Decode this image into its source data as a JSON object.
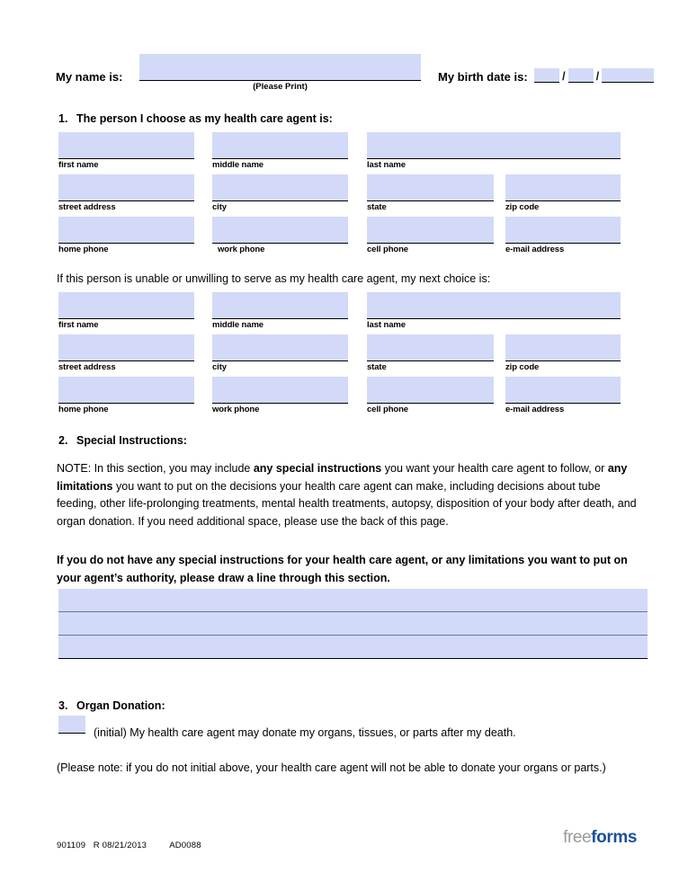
{
  "header": {
    "name_label": "My name is:",
    "please_print": "(Please Print)",
    "birth_label": "My birth date is:",
    "birth_month": "",
    "birth_day": "",
    "birth_year": "",
    "slash": "/",
    "name_value": ""
  },
  "section1": {
    "number": "1.",
    "title": "The person I choose as my health care agent is:",
    "alternate_intro": "If this person is unable or unwilling to serve as my health care agent, my next choice is:",
    "captions": {
      "first_name": "first name",
      "middle_name": "middle name",
      "last_name": "last name",
      "street_address": "street address",
      "city": "city",
      "state": "state",
      "zip_code": "zip code",
      "home_phone": "home phone",
      "work_phone": "work phone",
      "cell_phone": "cell phone",
      "email_address": "e-mail address"
    },
    "primary_values": {
      "first_name": "",
      "middle_name": "",
      "last_name": "",
      "street_address": "",
      "city": "",
      "state": "",
      "zip_code": "",
      "home_phone": "",
      "work_phone": "",
      "cell_phone": "",
      "email_address": ""
    },
    "alternate_values": {
      "first_name": "",
      "middle_name": "",
      "last_name": "",
      "street_address": "",
      "city": "",
      "state": "",
      "zip_code": "",
      "home_phone": "",
      "work_phone": "",
      "cell_phone": "",
      "email_address": ""
    }
  },
  "section2": {
    "number": "2.",
    "title": "Special Instructions:",
    "note_prefix": "NOTE:  In this section, you may include ",
    "note_bold_1": "any special instructions",
    "note_mid_1": " you want your health care agent to follow, or ",
    "note_bold_2": "any limitations",
    "note_rest": " you want to put on the decisions your health care agent can make, including decisions about tube feeding, other life-prolonging treatments, mental health treatments, autopsy, disposition of  your body after death, and organ donation.  If you need additional space, please use the back of this page.",
    "bold_paragraph": "If you do not have any special instructions for your health care agent, or any limitations you want to put on your agent’s authority, please draw a line through this section.",
    "textarea_lines": [
      "",
      "",
      ""
    ]
  },
  "section3": {
    "number": "3.",
    "title": "Organ Donation:",
    "initial_value": "",
    "initial_text": "(initial)  My health care agent may donate my organs, tissues, or parts after my death.",
    "please_note": "(Please note:  if you do not initial above, your health care agent will not be able to donate your organs or parts.)"
  },
  "footer": {
    "code": "901109   R 08/21/2013         AD0088",
    "logo_free": "free",
    "logo_forms": "forms"
  },
  "colors": {
    "field_fill": "#d2daf8",
    "rule": "#000000",
    "logo_blue": "#1b4f9c",
    "logo_gray": "#9a9a9a"
  }
}
